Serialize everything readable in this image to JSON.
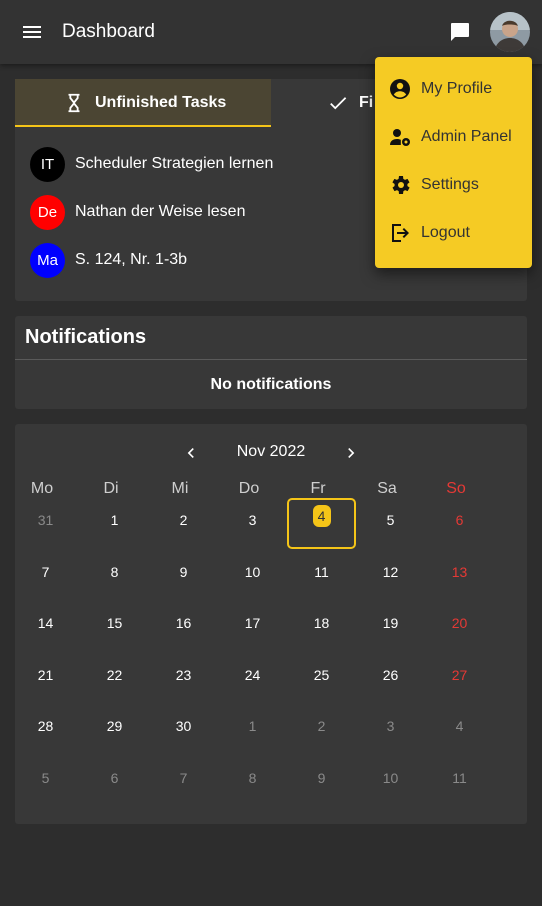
{
  "appbar": {
    "title": "Dashboard"
  },
  "tasks": {
    "tabs": [
      {
        "label": "Unfinished Tasks",
        "icon": "hourglass-icon",
        "active": true
      },
      {
        "label": "Fi",
        "icon": "check-icon",
        "active": false
      }
    ],
    "items": [
      {
        "badge": "IT",
        "badge_color": "#000000",
        "label": "Scheduler Strategien lernen"
      },
      {
        "badge": "De",
        "badge_color": "#ff0000",
        "label": "Nathan der Weise lesen"
      },
      {
        "badge": "Ma",
        "badge_color": "#0000ff",
        "label": "S. 124, Nr. 1-3b"
      }
    ]
  },
  "notifications": {
    "title": "Notifications",
    "empty_text": "No notifications"
  },
  "calendar": {
    "month_label": "Nov 2022",
    "weekdays": [
      "Mo",
      "Di",
      "Mi",
      "Do",
      "Fr",
      "Sa",
      "So"
    ],
    "weeks": [
      [
        "31",
        "1",
        "2",
        "3",
        "4",
        "5",
        "6"
      ],
      [
        "7",
        "8",
        "9",
        "10",
        "11",
        "12",
        "13"
      ],
      [
        "14",
        "15",
        "16",
        "17",
        "18",
        "19",
        "20"
      ],
      [
        "21",
        "22",
        "23",
        "24",
        "25",
        "26",
        "27"
      ],
      [
        "28",
        "29",
        "30",
        "1",
        "2",
        "3",
        "4"
      ],
      [
        "5",
        "6",
        "7",
        "8",
        "9",
        "10",
        "11"
      ]
    ],
    "today": "4"
  },
  "menu": {
    "items": [
      {
        "label": "My Profile",
        "icon": "account-circle-icon"
      },
      {
        "label": "Admin Panel",
        "icon": "admin-user-gear-icon"
      },
      {
        "label": "Settings",
        "icon": "settings-gear-icon"
      },
      {
        "label": "Logout",
        "icon": "logout-icon"
      }
    ]
  },
  "colors": {
    "accent": "#f5c518",
    "sunday": "#e53935",
    "background": "#2d2d2d",
    "card": "#383838"
  }
}
